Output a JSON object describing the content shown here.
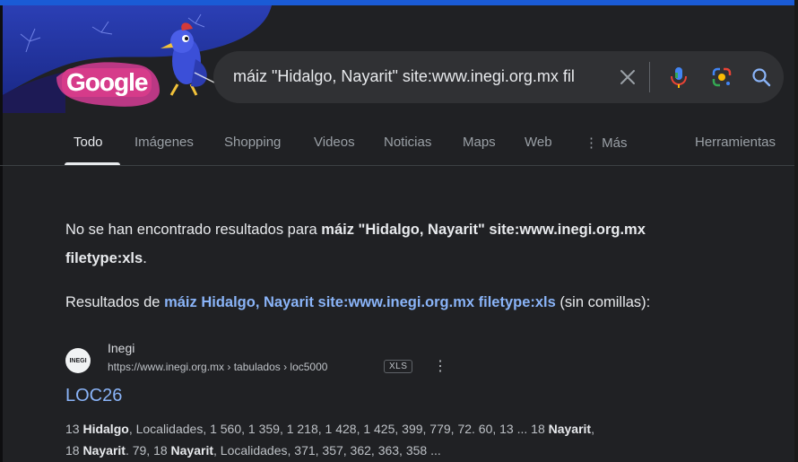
{
  "doodle": {
    "logo_text": "Google"
  },
  "search": {
    "query": "máiz \"Hidalgo, Nayarit\" site:www.inegi.org.mx fil",
    "icons": [
      "close-icon",
      "mic-icon",
      "lens-icon",
      "search-icon"
    ]
  },
  "tabs": {
    "todo": "Todo",
    "imagenes": "Imágenes",
    "shopping": "Shopping",
    "videos": "Videos",
    "noticias": "Noticias",
    "maps": "Maps",
    "web": "Web",
    "mas": "⋮ Más",
    "herramientas": "Herramientas"
  },
  "message": {
    "no_results_prefix": "No se han encontrado resultados para ",
    "no_results_query_line1": "máiz \"Hidalgo, Nayarit\" site:www.inegi.org.mx",
    "no_results_query_line2": "filetype:xls",
    "no_results_suffix": ".",
    "results_prefix": "Resultados de ",
    "results_link": "máiz Hidalgo, Nayarit site:www.inegi.org.mx filetype:xls",
    "results_suffix": " (sin comillas):"
  },
  "result": {
    "favicon_text": "INEGI",
    "site_name": "Inegi",
    "url": "https://www.inegi.org.mx › tabulados › loc5000",
    "file_badge": "XLS",
    "more": "⋮",
    "title": "LOC26",
    "snippet": {
      "s1": "13 ",
      "b1": "Hidalgo",
      "s2": ", Localidades, 1 560, 1 359, 1 218, 1 428, 1 425, 399, 779, 72. 60, 13 ... 18 ",
      "b2": "Nayarit",
      "s3": ",",
      "s4": "18 ",
      "b3": "Nayarit",
      "s5": ". 79, 18 ",
      "b4": "Nayarit",
      "s6": ", Localidades, 371, 357, 362, 363, 358 ..."
    }
  },
  "colors": {
    "background": "#202124",
    "link": "#8ab4f8",
    "searchbar": "#303134"
  }
}
